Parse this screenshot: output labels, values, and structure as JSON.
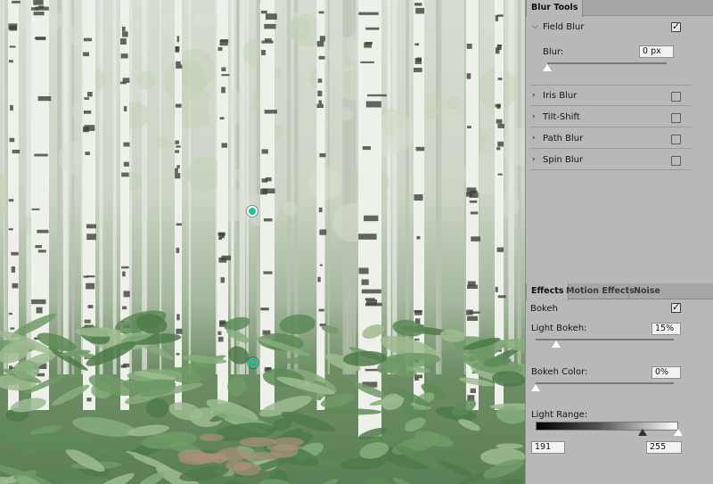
{
  "blur_tools": {
    "tab_label": "Blur Tools",
    "field_blur": {
      "label": "Field Blur",
      "checked": true,
      "blur_label": "Blur:",
      "blur_value": "0 px",
      "slider_fraction": 0.0
    },
    "items": [
      {
        "label": "Iris Blur",
        "checked": false
      },
      {
        "label": "Tilt-Shift",
        "checked": false
      },
      {
        "label": "Path Blur",
        "checked": false
      },
      {
        "label": "Spin Blur",
        "checked": false
      }
    ]
  },
  "effects": {
    "tabs": [
      "Effects",
      "Motion Effects",
      "Noise"
    ],
    "bokeh_label": "Bokeh",
    "bokeh_checked": true,
    "light_bokeh_label": "Light Bokeh:",
    "light_bokeh_value": "15%",
    "light_bokeh_fraction": 0.15,
    "bokeh_color_label": "Bokeh Color:",
    "bokeh_color_value": "0%",
    "bokeh_color_fraction": 0.0,
    "light_range_label": "Light Range:",
    "light_range_low": "191",
    "light_range_high": "255",
    "light_range_low_fraction": 0.749,
    "light_range_high_fraction": 1.0
  },
  "colors": {
    "pin_accent": "#19c49a",
    "panel_bg": "#b8b8b8"
  },
  "icons": {
    "expand": "chevron-down-icon",
    "collapse": "chevron-right-icon"
  }
}
